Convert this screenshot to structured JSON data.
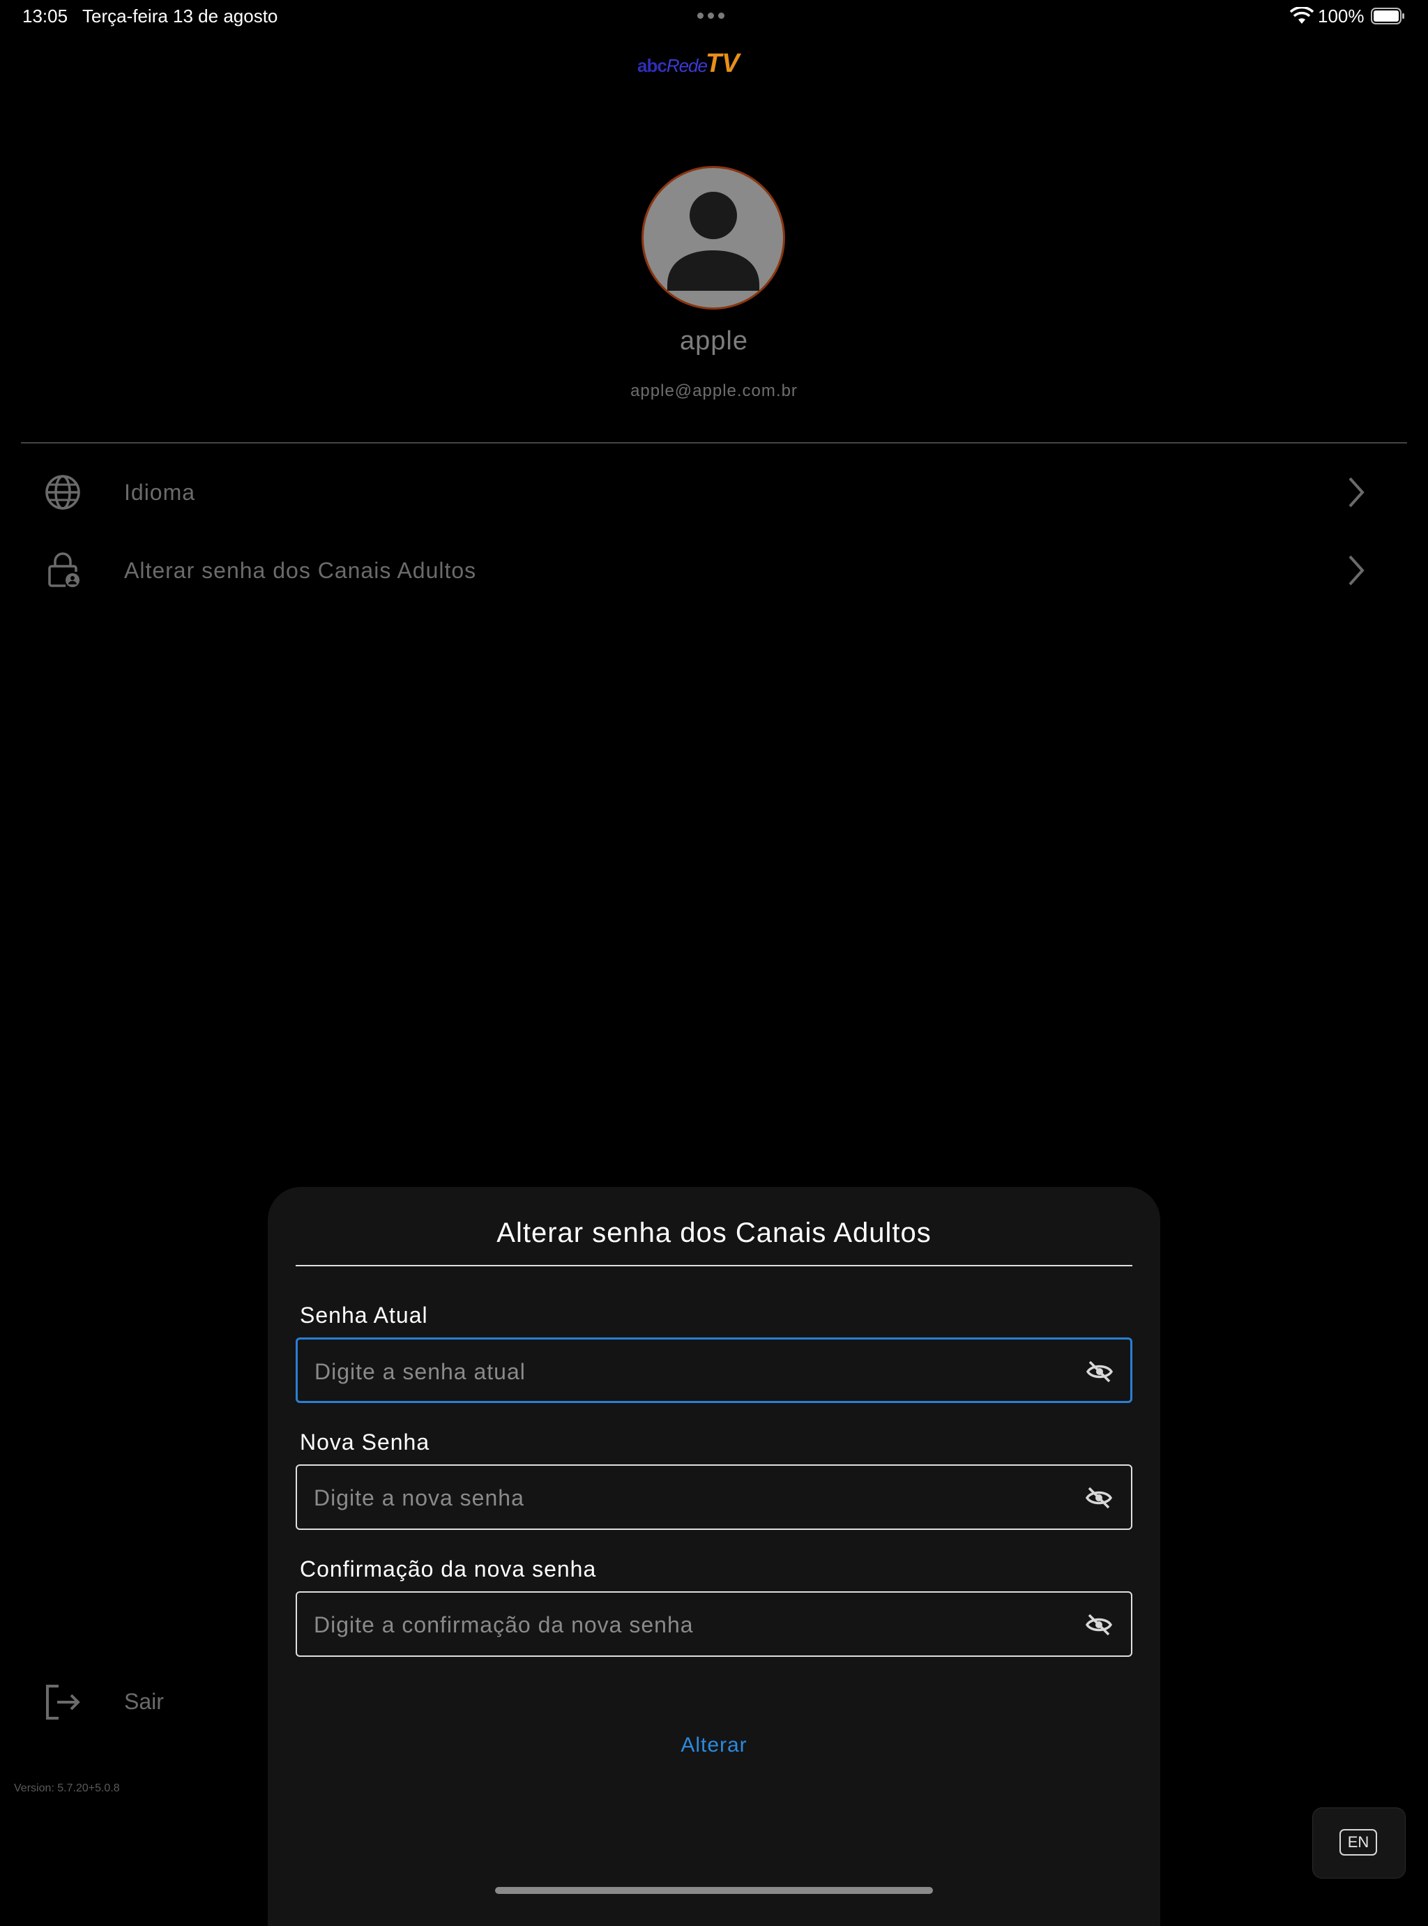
{
  "status_bar": {
    "time": "13:05",
    "date": "Terça-feira 13 de agosto",
    "battery": "100%"
  },
  "brand": {
    "logo_part1": "abc",
    "logo_part2": "Rede",
    "logo_part3": "TV",
    "colors": {
      "abc": "#2e2eb8",
      "rede": "#3b3bd6",
      "tv": "#e8901a"
    }
  },
  "profile": {
    "name": "apple",
    "email": "apple@apple.com.br",
    "avatar_icon": "user-silhouette-icon"
  },
  "menu": {
    "items": [
      {
        "label": "Idioma",
        "icon": "globe-icon"
      },
      {
        "label": "Alterar senha dos Canais Adultos",
        "icon": "lock-icon"
      }
    ]
  },
  "logout": {
    "label": "Sair",
    "icon": "logout-icon"
  },
  "version": "Version: 5.7.20+5.0.8",
  "modal": {
    "title": "Alterar senha dos Canais Adultos",
    "fields": [
      {
        "label": "Senha Atual",
        "placeholder": "Digite a senha atual",
        "value": ""
      },
      {
        "label": "Nova Senha",
        "placeholder": "Digite a nova senha",
        "value": ""
      },
      {
        "label": "Confirmação da nova senha",
        "placeholder": "Digite a confirmação da nova senha",
        "value": ""
      }
    ],
    "submit_label": "Alterar",
    "accent_color": "#2a7fd4"
  },
  "keyboard_language": "EN"
}
